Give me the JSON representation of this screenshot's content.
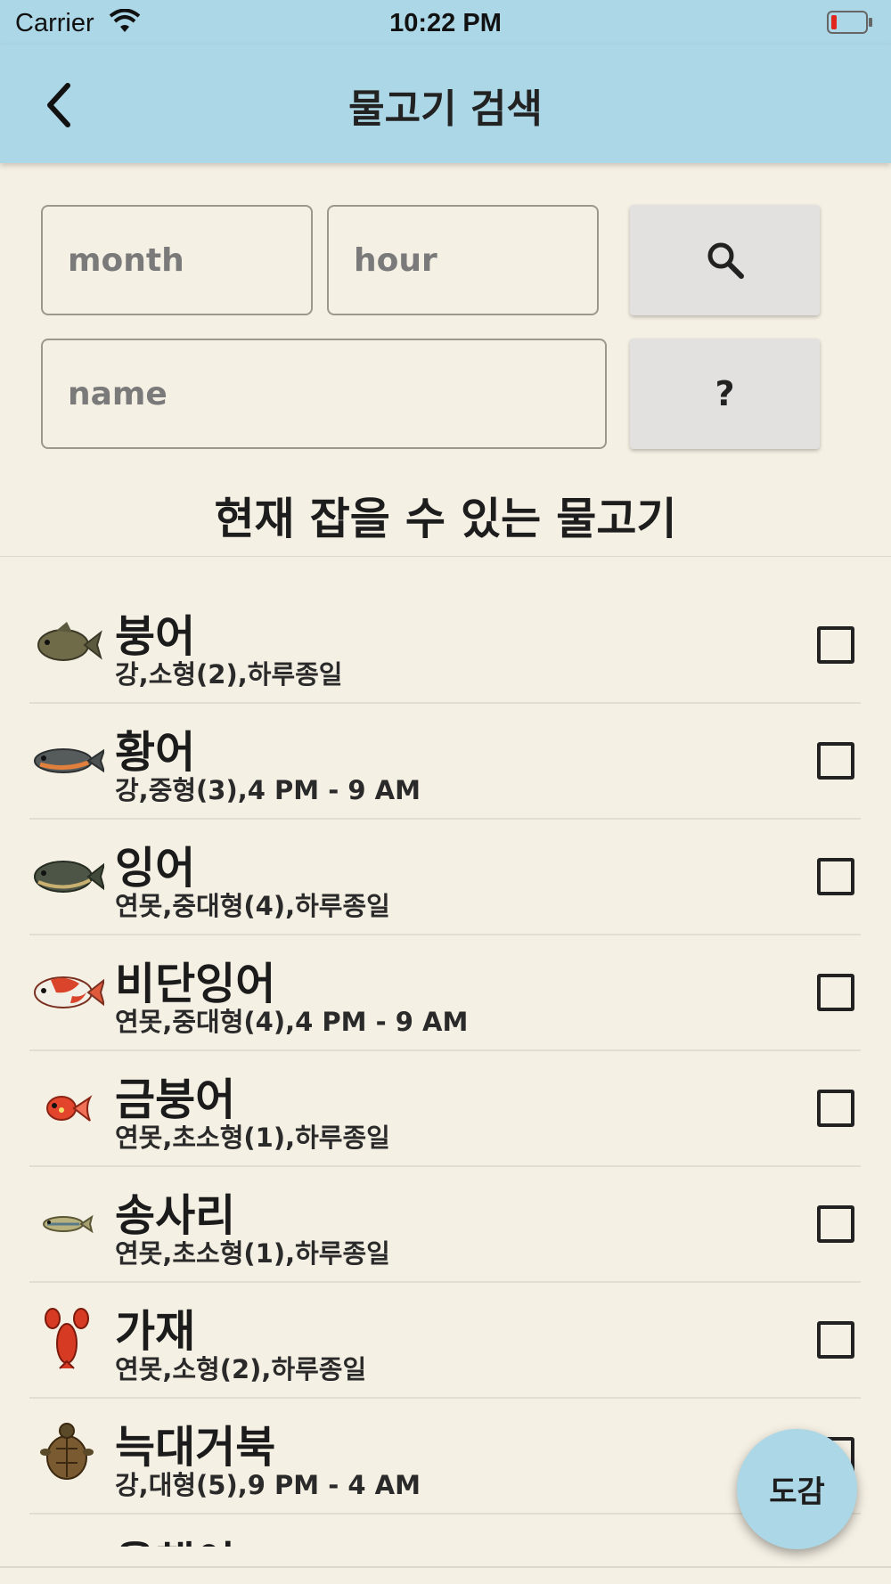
{
  "status_bar": {
    "carrier": "Carrier",
    "time": "10:22 PM"
  },
  "header": {
    "title": "물고기 검색"
  },
  "search": {
    "month_placeholder": "month",
    "hour_placeholder": "hour",
    "name_placeholder": "name",
    "help_label": "?"
  },
  "section_title": "현재 잡을 수 있는 물고기",
  "fish": [
    {
      "name": "붕어",
      "info": "강,소형(2),하루종일",
      "icon": "crucian-carp-icon",
      "checked": false
    },
    {
      "name": "황어",
      "info": "강,중형(3),4 PM - 9 AM",
      "icon": "dace-icon",
      "checked": false
    },
    {
      "name": "잉어",
      "info": "연못,중대형(4),하루종일",
      "icon": "carp-icon",
      "checked": false
    },
    {
      "name": "비단잉어",
      "info": "연못,중대형(4),4 PM - 9 AM",
      "icon": "koi-icon",
      "checked": false
    },
    {
      "name": "금붕어",
      "info": "연못,초소형(1),하루종일",
      "icon": "goldfish-icon",
      "checked": false
    },
    {
      "name": "송사리",
      "info": "연못,초소형(1),하루종일",
      "icon": "killifish-icon",
      "checked": false
    },
    {
      "name": "가재",
      "info": "연못,소형(2),하루종일",
      "icon": "crawfish-icon",
      "checked": false
    },
    {
      "name": "늑대거북",
      "info": "강,대형(5),9 PM - 4 AM",
      "icon": "snapping-turtle-icon",
      "checked": false
    },
    {
      "name": "올챙이",
      "info": "",
      "icon": "tadpole-icon",
      "checked": false
    }
  ],
  "fab_label": "도감"
}
